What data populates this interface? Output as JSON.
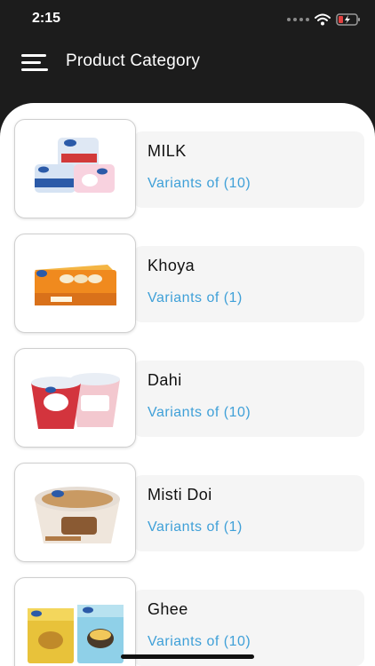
{
  "status": {
    "time": "2:15"
  },
  "header": {
    "title": "Product Category"
  },
  "categories": [
    {
      "name": "MILK",
      "variants": "Variants of (10)",
      "icon": "milk-packets-icon"
    },
    {
      "name": "Khoya",
      "variants": "Variants of (1)",
      "icon": "khoya-box-icon"
    },
    {
      "name": "Dahi",
      "variants": "Variants of (10)",
      "icon": "dahi-cups-icon"
    },
    {
      "name": "Misti Doi",
      "variants": "Variants of (1)",
      "icon": "misti-doi-cup-icon"
    },
    {
      "name": "Ghee",
      "variants": "Variants of (10)",
      "icon": "ghee-boxes-icon"
    }
  ],
  "colors": {
    "header_bg": "#1c1c1c",
    "accent_link": "#3fa0d8",
    "card_bg": "#f5f5f5"
  }
}
